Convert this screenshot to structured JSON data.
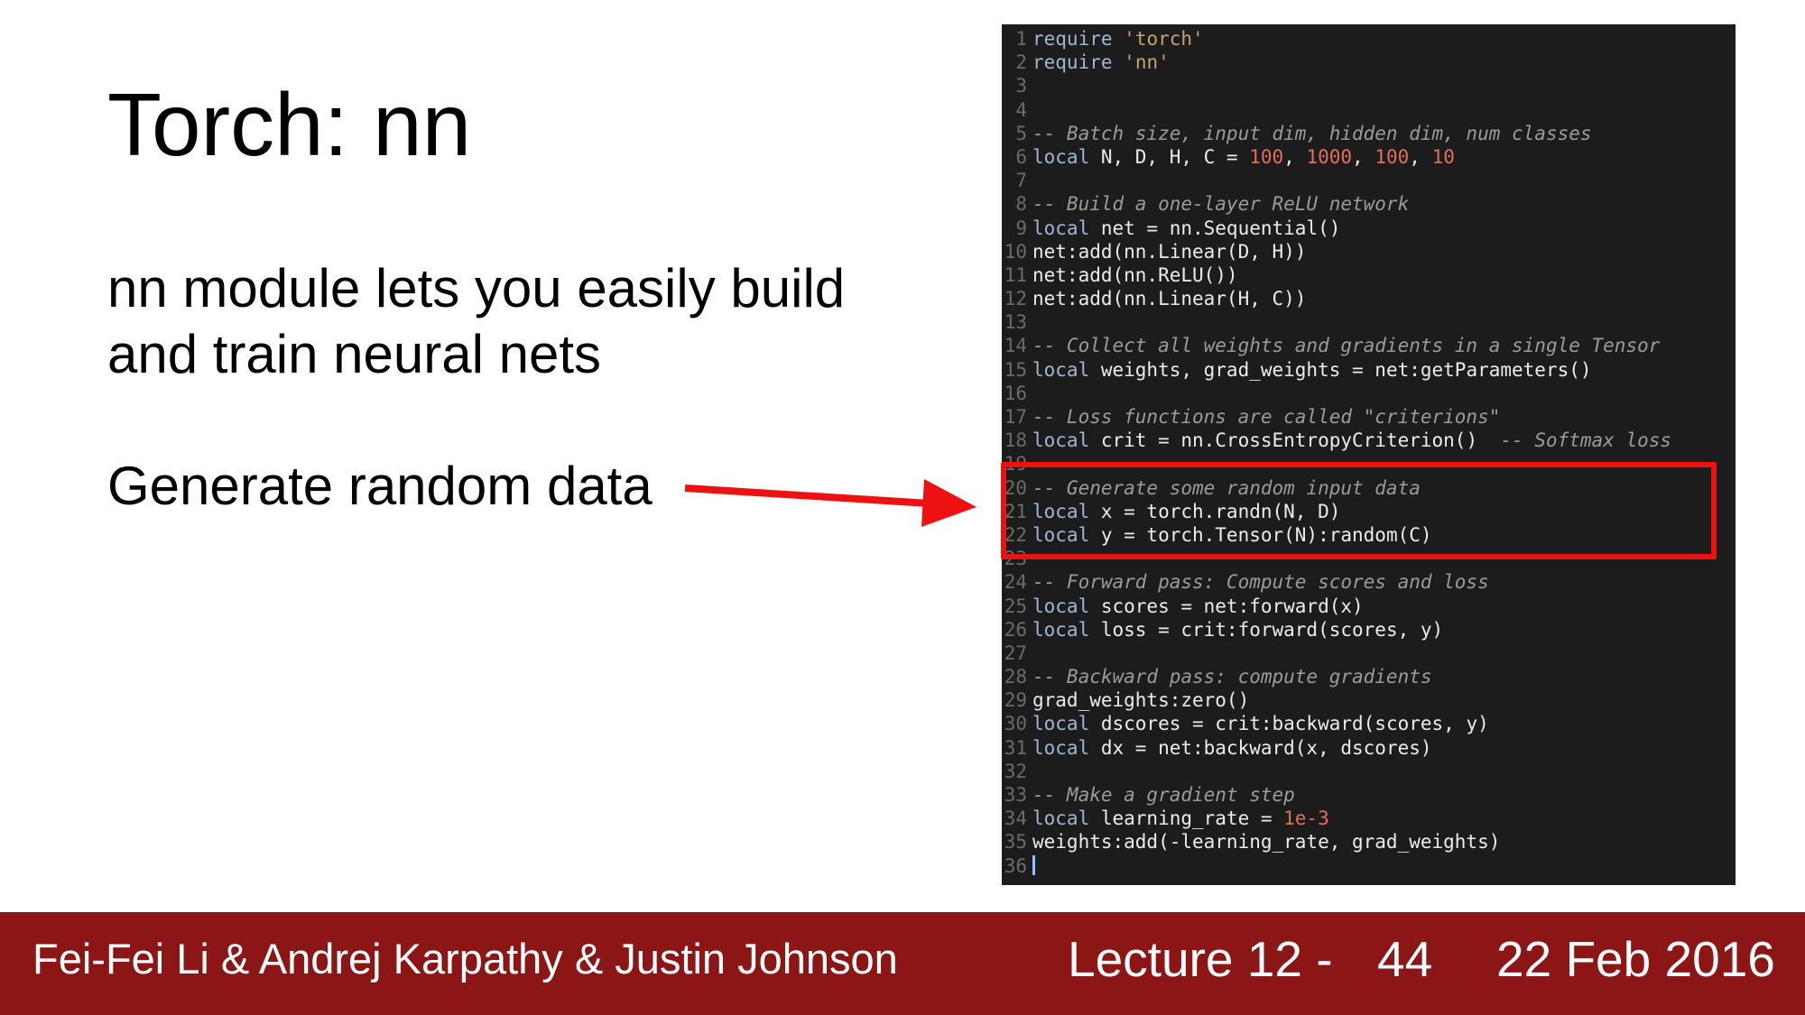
{
  "slide": {
    "title": "Torch: nn",
    "bullets": {
      "line1": "nn module lets you easily build",
      "line2": "and train neural nets",
      "line3": "Generate random data"
    }
  },
  "code": {
    "lines": [
      {
        "n": "1",
        "parts": [
          [
            "kw",
            "require"
          ],
          [
            "t",
            " "
          ],
          [
            "str",
            "'torch'"
          ]
        ]
      },
      {
        "n": "2",
        "parts": [
          [
            "kw",
            "require"
          ],
          [
            "t",
            " "
          ],
          [
            "str",
            "'nn'"
          ]
        ]
      },
      {
        "n": "3",
        "parts": []
      },
      {
        "n": "4",
        "parts": []
      },
      {
        "n": "5",
        "parts": [
          [
            "cm",
            "-- Batch size, input dim, hidden dim, num classes"
          ]
        ]
      },
      {
        "n": "6",
        "parts": [
          [
            "kw",
            "local"
          ],
          [
            "t",
            " N, D, H, C = "
          ],
          [
            "num",
            "100"
          ],
          [
            "t",
            ", "
          ],
          [
            "num",
            "1000"
          ],
          [
            "t",
            ", "
          ],
          [
            "num",
            "100"
          ],
          [
            "t",
            ", "
          ],
          [
            "num",
            "10"
          ]
        ]
      },
      {
        "n": "7",
        "parts": []
      },
      {
        "n": "8",
        "parts": [
          [
            "cm",
            "-- Build a one-layer ReLU network"
          ]
        ]
      },
      {
        "n": "9",
        "parts": [
          [
            "kw",
            "local"
          ],
          [
            "t",
            " net = nn.Sequential()"
          ]
        ]
      },
      {
        "n": "10",
        "parts": [
          [
            "t",
            "net:add(nn.Linear(D, H))"
          ]
        ]
      },
      {
        "n": "11",
        "parts": [
          [
            "t",
            "net:add(nn.ReLU())"
          ]
        ]
      },
      {
        "n": "12",
        "parts": [
          [
            "t",
            "net:add(nn.Linear(H, C))"
          ]
        ]
      },
      {
        "n": "13",
        "parts": []
      },
      {
        "n": "14",
        "parts": [
          [
            "cm",
            "-- Collect all weights and gradients in a single Tensor"
          ]
        ]
      },
      {
        "n": "15",
        "parts": [
          [
            "kw",
            "local"
          ],
          [
            "t",
            " weights, grad_weights = net:getParameters()"
          ]
        ]
      },
      {
        "n": "16",
        "parts": []
      },
      {
        "n": "17",
        "parts": [
          [
            "cm",
            "-- Loss functions are called \"criterions\""
          ]
        ]
      },
      {
        "n": "18",
        "parts": [
          [
            "kw",
            "local"
          ],
          [
            "t",
            " crit = nn.CrossEntropyCriterion()  "
          ],
          [
            "cm",
            "-- Softmax loss"
          ]
        ]
      },
      {
        "n": "19",
        "parts": []
      },
      {
        "n": "20",
        "parts": [
          [
            "cm",
            "-- Generate some random input data"
          ]
        ]
      },
      {
        "n": "21",
        "parts": [
          [
            "kw",
            "local"
          ],
          [
            "t",
            " x = torch.randn(N, D)"
          ]
        ]
      },
      {
        "n": "22",
        "parts": [
          [
            "kw",
            "local"
          ],
          [
            "t",
            " y = torch.Tensor(N):random(C)"
          ]
        ]
      },
      {
        "n": "23",
        "parts": []
      },
      {
        "n": "24",
        "parts": [
          [
            "cm",
            "-- Forward pass: Compute scores and loss"
          ]
        ]
      },
      {
        "n": "25",
        "parts": [
          [
            "kw",
            "local"
          ],
          [
            "t",
            " scores = net:forward(x)"
          ]
        ]
      },
      {
        "n": "26",
        "parts": [
          [
            "kw",
            "local"
          ],
          [
            "t",
            " loss = crit:forward(scores, y)"
          ]
        ]
      },
      {
        "n": "27",
        "parts": []
      },
      {
        "n": "28",
        "parts": [
          [
            "cm",
            "-- Backward pass: compute gradients"
          ]
        ]
      },
      {
        "n": "29",
        "parts": [
          [
            "t",
            "grad_weights:zero()"
          ]
        ]
      },
      {
        "n": "30",
        "parts": [
          [
            "kw",
            "local"
          ],
          [
            "t",
            " dscores = crit:backward(scores, y)"
          ]
        ]
      },
      {
        "n": "31",
        "parts": [
          [
            "kw",
            "local"
          ],
          [
            "t",
            " dx = net:backward(x, dscores)"
          ]
        ]
      },
      {
        "n": "32",
        "parts": []
      },
      {
        "n": "33",
        "parts": [
          [
            "cm",
            "-- Make a gradient step"
          ]
        ]
      },
      {
        "n": "34",
        "parts": [
          [
            "kw",
            "local"
          ],
          [
            "t",
            " learning_rate = "
          ],
          [
            "num",
            "1e-3"
          ]
        ]
      },
      {
        "n": "35",
        "parts": [
          [
            "t",
            "weights:add(-learning_rate, grad_weights)"
          ]
        ]
      },
      {
        "n": "36",
        "parts": [
          [
            "cursor",
            ""
          ]
        ]
      }
    ]
  },
  "footer": {
    "authors": "Fei-Fei Li & Andrej Karpathy & Justin Johnson",
    "lecture": "Lecture 12 -",
    "page": "44",
    "date": "22 Feb 2016"
  },
  "colors": {
    "footer_bg": "#8c1515",
    "highlight": "#ee1111",
    "code_bg": "#1c1c1c"
  }
}
